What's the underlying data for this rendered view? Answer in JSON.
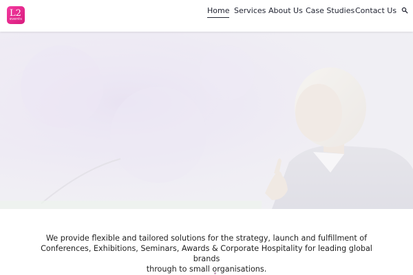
{
  "logo": {
    "mark": "L2",
    "sub": "events"
  },
  "nav": {
    "items": [
      {
        "label": "Home",
        "active": true
      },
      {
        "label": "Services",
        "active": false
      },
      {
        "label": "About Us",
        "active": false
      },
      {
        "label": "Case Studies",
        "active": false
      },
      {
        "label": "Contact Us",
        "active": false
      }
    ],
    "search_icon": "search-icon"
  },
  "hero": {
    "image": "woman speaking at a podium, pointing, faded purple background"
  },
  "intro": {
    "lines": [
      "We provide flexible and tailored solutions for the strategy, launch and fulfillment of",
      "Conferences, Exhibitions, Seminars, Awards & Corporate Hospitality for leading global brands",
      "through to small organisations."
    ]
  },
  "colors": {
    "brand": "#e0268a",
    "nav_text": "#1f2230",
    "hero_tint": "#e8e4f0"
  }
}
